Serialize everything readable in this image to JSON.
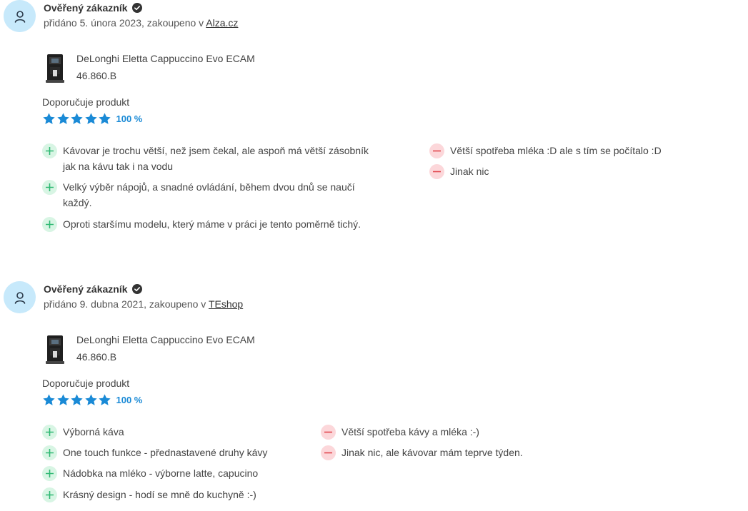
{
  "reviews": [
    {
      "author": "Ověřený zákazník",
      "meta_prefix": "přidáno 5. února 2023, zakoupeno v ",
      "shop": "Alza.cz",
      "product_name": "DeLonghi Eletta Cappuccino Evo ECAM",
      "product_price": "46.860.B",
      "recommend": "Doporučuje produkt",
      "stars": 5,
      "rating_pct": "100 %",
      "pros": [
        "Kávovar je trochu větší, než jsem čekal, ale aspoň má větší zásobník jak na kávu tak i na vodu",
        "Velký výběr nápojů, a snadné ovládání, během dvou dnů se naučí každý.",
        "Oproti staršímu modelu, který máme v práci je tento poměrně tichý."
      ],
      "cons": [
        "Větší spotřeba mléka :D ale s tím se počítalo :D",
        "Jinak nic"
      ]
    },
    {
      "author": "Ověřený zákazník",
      "meta_prefix": "přidáno 9. dubna 2021, zakoupeno v ",
      "shop": "TEshop",
      "product_name": "DeLonghi Eletta Cappuccino Evo ECAM",
      "product_price": "46.860.B",
      "recommend": "Doporučuje produkt",
      "stars": 5,
      "rating_pct": "100 %",
      "pros": [
        "Výborná káva",
        "One touch funkce - přednastavené druhy kávy",
        "Nádobka na mléko - výborne latte, capucino",
        "Krásný design - hodí se mně do kuchyně :-)"
      ],
      "cons": [
        "Větší spotřeba kávy a mléka :-)",
        "Jinak nic, ale kávovar mám teprve týden."
      ]
    }
  ],
  "colors": {
    "avatar_bg": "#c7e9fb",
    "star": "#1a8ad6",
    "pro_bg": "#d8f5e4",
    "pro_icon": "#2eb872",
    "con_bg": "#fcd7da",
    "con_icon": "#e2474f"
  },
  "icons": {
    "avatar": "user-icon",
    "verified": "check-badge-icon",
    "pro": "plus-icon",
    "con": "minus-icon",
    "star": "star-icon"
  }
}
